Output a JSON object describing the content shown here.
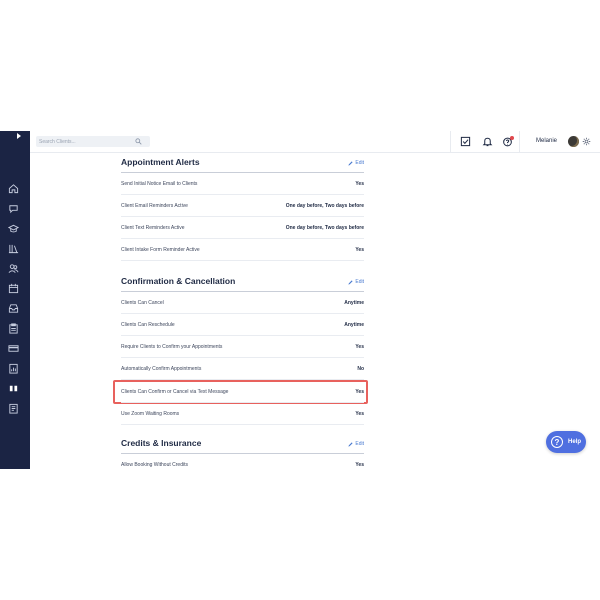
{
  "topbar": {
    "search_placeholder": "Search Clients...",
    "user_name": "Melanie"
  },
  "sidebar": {
    "items": [
      {
        "icon": "home-icon"
      },
      {
        "icon": "chat-icon"
      },
      {
        "icon": "education-icon"
      },
      {
        "icon": "library-icon"
      },
      {
        "icon": "clients-icon"
      },
      {
        "icon": "calendar-icon"
      },
      {
        "icon": "inbox-icon"
      },
      {
        "icon": "clipboard-icon"
      },
      {
        "icon": "billing-icon"
      },
      {
        "icon": "reports-icon"
      },
      {
        "icon": "team-icon"
      },
      {
        "icon": "documents-icon"
      }
    ]
  },
  "sections": {
    "alerts": {
      "title": "Appointment Alerts",
      "edit_label": "Edit",
      "rows": [
        {
          "label": "Send Initial Notice Email to Clients",
          "value": "Yes"
        },
        {
          "label": "Client Email Reminders Active",
          "value": "One day before, Two days before"
        },
        {
          "label": "Client Text Reminders Active",
          "value": "One day before, Two days before"
        },
        {
          "label": "Client Intake Form Reminder Active",
          "value": "Yes"
        }
      ]
    },
    "confirmation": {
      "title": "Confirmation & Cancellation",
      "edit_label": "Edit",
      "rows": [
        {
          "label": "Clients Can Cancel",
          "value": "Anytime"
        },
        {
          "label": "Clients Can Reschedule",
          "value": "Anytime"
        },
        {
          "label": "Require Clients to Confirm your Appointments",
          "value": "Yes"
        },
        {
          "label": "Automatically Confirm Appointments",
          "value": "No"
        },
        {
          "label": "Clients Can Confirm or Cancel via Text Message",
          "value": "Yes"
        },
        {
          "label": "Use Zoom Waiting Rooms",
          "value": "Yes"
        }
      ]
    },
    "credits": {
      "title": "Credits & Insurance",
      "edit_label": "Edit",
      "rows": [
        {
          "label": "Allow Booking Without Credits",
          "value": "Yes"
        }
      ]
    }
  },
  "help": {
    "label": "Help",
    "glyph": "?"
  },
  "colors": {
    "sidebar": "#1b2444",
    "accent": "#4a7bd0",
    "help_button": "#4f6fe0",
    "highlight": "#e8615d",
    "notification_dot": "#e0474c"
  }
}
